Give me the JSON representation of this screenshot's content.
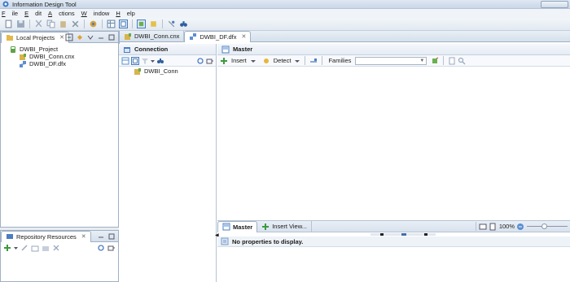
{
  "app": {
    "title": "Information Design Tool"
  },
  "menu": [
    "File",
    "Edit",
    "Actions",
    "Window",
    "Help"
  ],
  "left_panel": {
    "tab_label": "Local Projects",
    "tree": {
      "project": "DWBI_Project",
      "files": [
        "DWBI_Conn.cnx",
        "DWBI_DF.dfx"
      ]
    }
  },
  "repo_panel": {
    "tab_label": "Repository Resources"
  },
  "editor_tabs": [
    "DWBI_Conn.cnx",
    "DWBI_DF.dfx"
  ],
  "connection_pane": {
    "title": "Connection",
    "item": "DWBI_Conn"
  },
  "master_pane": {
    "title": "Master",
    "insert_label": "Insert",
    "detect_label": "Detect",
    "families_label": "Families",
    "families_value": ""
  },
  "bottom_tabs": {
    "master": "Master",
    "insert_view": "Insert View...",
    "zoom": "100%"
  },
  "properties": {
    "message": "No properties to display."
  }
}
